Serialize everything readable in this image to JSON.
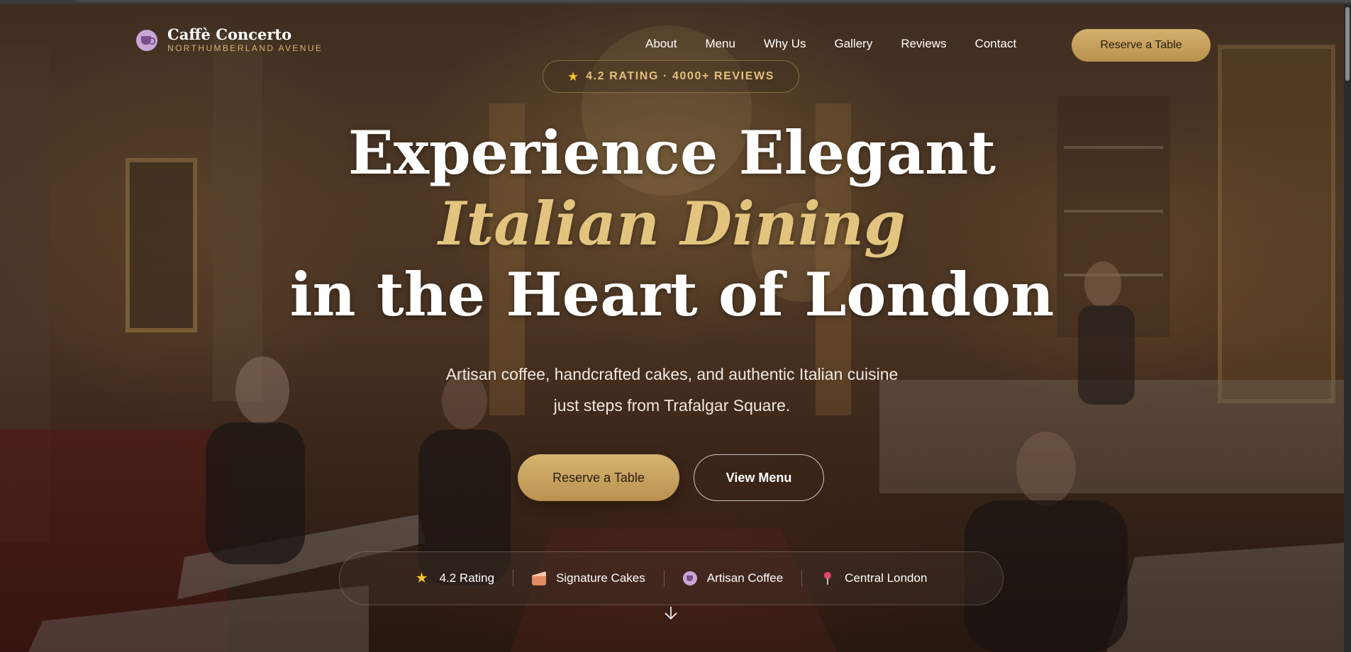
{
  "brand": {
    "name": "Caffè Concerto",
    "subtitle": "NORTHUMBERLAND AVENUE",
    "icon": "coffee-cup-icon"
  },
  "nav": {
    "items": [
      "About",
      "Menu",
      "Why Us",
      "Gallery",
      "Reviews",
      "Contact"
    ],
    "cta_label": "Reserve a Table"
  },
  "rating_badge": {
    "icon": "star-icon",
    "text": "4.2 RATING · 4000+ REVIEWS"
  },
  "hero": {
    "line1": "Experience Elegant",
    "line2": "Italian Dining",
    "line3": "in the Heart of London",
    "subtitle_line1": "Artisan coffee, handcrafted cakes, and authentic Italian cuisine",
    "subtitle_line2": "just steps from Trafalgar Square.",
    "primary_button": "Reserve a Table",
    "secondary_button": "View Menu"
  },
  "features": [
    {
      "icon": "star-icon",
      "label": "4.2 Rating"
    },
    {
      "icon": "cake-icon",
      "label": "Signature Cakes"
    },
    {
      "icon": "coffee-cup-icon",
      "label": "Artisan Coffee"
    },
    {
      "icon": "location-pin-icon",
      "label": "Central London"
    }
  ],
  "colors": {
    "accent_gold": "#d6b470",
    "accent_text_gold": "#e3c47e",
    "star": "#f2c230"
  }
}
